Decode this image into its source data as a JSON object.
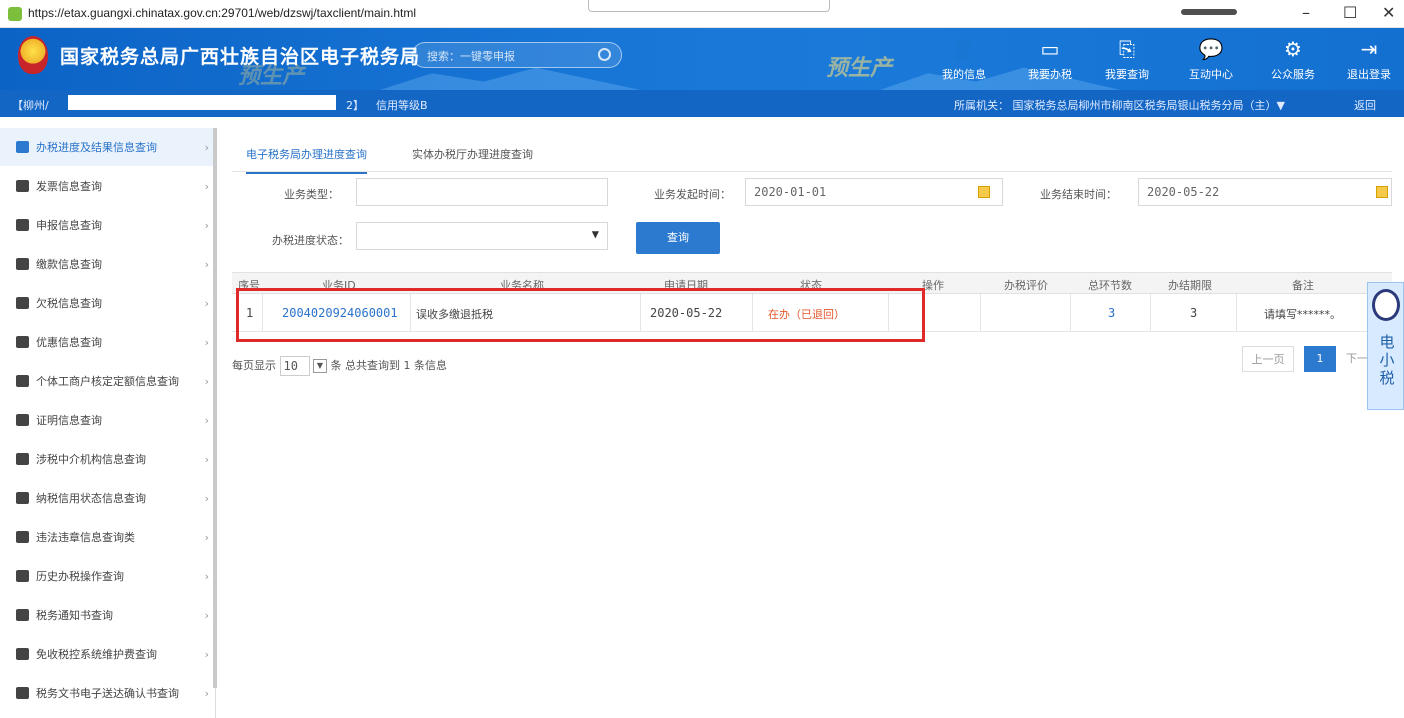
{
  "browser": {
    "url": "https://etax.guangxi.chinatax.gov.cn:29701/web/dzswj/taxclient/main.html",
    "window_buttons": [
      "–",
      "☐",
      "✕"
    ]
  },
  "header": {
    "brand": "国家税务总局广西壮族自治区电子税务局",
    "search_placeholder": "搜索：一键零申报",
    "watermark": "预生产",
    "nav": [
      {
        "label": "我的信息",
        "icon": "user-icon"
      },
      {
        "label": "我要办税",
        "icon": "monitor-icon"
      },
      {
        "label": "我要查询",
        "icon": "search-doc-icon"
      },
      {
        "label": "互动中心",
        "icon": "chat-icon"
      },
      {
        "label": "公众服务",
        "icon": "service-icon"
      },
      {
        "label": "退出登录",
        "icon": "logout-icon"
      }
    ]
  },
  "infobar": {
    "location_prefix": "【柳州/",
    "location_suffix": "2】",
    "credit": "信用等级B",
    "org": "所属机关： 国家税务总局柳州市柳南区税务局银山税务分局（主）▼",
    "return": "返回"
  },
  "sidebar": {
    "items": [
      "办税进度及结果信息查询",
      "发票信息查询",
      "申报信息查询",
      "缴款信息查询",
      "欠税信息查询",
      "优惠信息查询",
      "个体工商户核定定额信息查询",
      "证明信息查询",
      "涉税中介机构信息查询",
      "纳税信用状态信息查询",
      "违法违章信息查询类",
      "历史办税操作查询",
      "税务通知书查询",
      "免收税控系统维护费查询",
      "税务文书电子送达确认书查询"
    ]
  },
  "tabs": [
    "电子税务局办理进度查询",
    "实体办税厅办理进度查询"
  ],
  "form": {
    "business_type_label": "业务类型：",
    "start_label": "业务发起时间：",
    "start_value": "2020-01-01",
    "end_label": "业务结束时间：",
    "end_value": "2020-05-22",
    "status_label": "办税进度状态：",
    "query_button": "查询"
  },
  "table": {
    "headers": [
      "序号",
      "业务ID",
      "业务名称",
      "申请日期",
      "状态",
      "操作",
      "办税评价",
      "总环节数",
      "办结期限",
      "备注"
    ],
    "rows": [
      {
        "no": "1",
        "id": "2004020924060001",
        "name": "误收多缴退抵税",
        "date": "2020-05-22",
        "status": "在办（已退回）",
        "op": "",
        "eval": "",
        "steps": "3",
        "deadline": "3",
        "remark": "请填写******。"
      }
    ]
  },
  "pager": {
    "per_page_prefix": "每页显示",
    "per_page": "10",
    "per_page_suffix": "条  总共查询到 1 条信息",
    "prev": "上一页",
    "current": "1",
    "next": "下一"
  },
  "assistant": {
    "label": "电小税"
  },
  "colors": {
    "accent": "#2b7ad0",
    "header": "#1775d6",
    "status_text": "#e5572b",
    "highlight": "#e02a2a"
  }
}
